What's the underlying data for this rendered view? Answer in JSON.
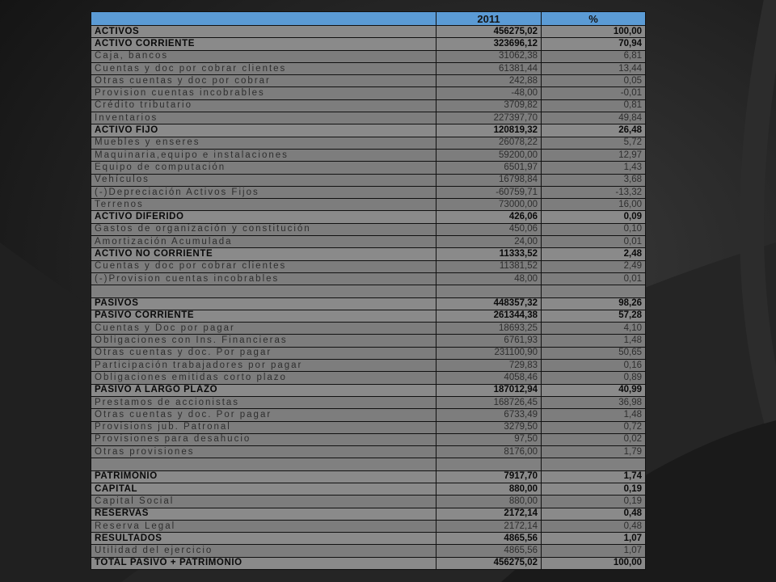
{
  "header": {
    "year": "2011",
    "pct": "%"
  },
  "rows": [
    {
      "label": "ACTIVOS",
      "value": "456275,02",
      "pct": "100,00",
      "bold": true
    },
    {
      "label": "ACTIVO CORRIENTE",
      "value": "323696,12",
      "pct": "70,94",
      "bold": true
    },
    {
      "label": "Caja, bancos",
      "value": "31062,38",
      "pct": "6,81",
      "bold": false
    },
    {
      "label": "Cuentas y doc por cobrar clientes",
      "value": "61381,44",
      "pct": "13,44",
      "bold": false
    },
    {
      "label": "Otras cuentas y doc por cobrar",
      "value": "242,88",
      "pct": "0,05",
      "bold": false
    },
    {
      "label": "Provision cuentas incobrables",
      "value": "-48,00",
      "pct": "-0,01",
      "bold": false
    },
    {
      "label": "Crédito tributario",
      "value": "3709,82",
      "pct": "0,81",
      "bold": false
    },
    {
      "label": "Inventarios",
      "value": "227397,70",
      "pct": "49,84",
      "bold": false
    },
    {
      "label": "ACTIVO FIJO",
      "value": "120819,32",
      "pct": "26,48",
      "bold": true
    },
    {
      "label": "Muebles y enseres",
      "value": "26078,22",
      "pct": "5,72",
      "bold": false
    },
    {
      "label": "Maquinaria,equipo e instalaciones",
      "value": "59200,00",
      "pct": "12,97",
      "bold": false
    },
    {
      "label": "Equipo de computación",
      "value": "6501,97",
      "pct": "1,43",
      "bold": false
    },
    {
      "label": "Vehículos",
      "value": "16798,84",
      "pct": "3,68",
      "bold": false
    },
    {
      "label": "(-)Depreciación Activos Fijos",
      "value": "-60759,71",
      "pct": "-13,32",
      "bold": false
    },
    {
      "label": "Terrenos",
      "value": "73000,00",
      "pct": "16,00",
      "bold": false
    },
    {
      "label": "ACTIVO DIFERIDO",
      "value": "426,06",
      "pct": "0,09",
      "bold": true
    },
    {
      "label": "Gastos de organización y constitución",
      "value": "450,06",
      "pct": "0,10",
      "bold": false
    },
    {
      "label": "Amortización Acumulada",
      "value": "24,00",
      "pct": "0,01",
      "bold": false
    },
    {
      "label": "ACTIVO NO CORRIENTE",
      "value": "11333,52",
      "pct": "2,48",
      "bold": true
    },
    {
      "label": "Cuentas y doc por cobrar clientes",
      "value": "11381,52",
      "pct": "2,49",
      "bold": false
    },
    {
      "label": "(-)Provision cuentas incobrables",
      "value": "48,00",
      "pct": "0,01",
      "bold": false
    },
    {
      "label": "",
      "value": "",
      "pct": "",
      "bold": false
    },
    {
      "label": "PASIVOS",
      "value": "448357,32",
      "pct": "98,26",
      "bold": true
    },
    {
      "label": "PASIVO CORRIENTE",
      "value": "261344,38",
      "pct": "57,28",
      "bold": true
    },
    {
      "label": "Cuentas y Doc por pagar",
      "value": "18693,25",
      "pct": "4,10",
      "bold": false
    },
    {
      "label": "Obligaciones con Ins. Financieras",
      "value": "6761,93",
      "pct": "1,48",
      "bold": false
    },
    {
      "label": "Otras cuentas y doc. Por pagar",
      "value": "231100,90",
      "pct": "50,65",
      "bold": false
    },
    {
      "label": "Participación trabajadores por pagar",
      "value": "729,83",
      "pct": "0,16",
      "bold": false
    },
    {
      "label": "Obligaciones emitidas corto plazo",
      "value": "4058,46",
      "pct": "0,89",
      "bold": false
    },
    {
      "label": "PASIVO A LARGO PLAZO",
      "value": "187012,94",
      "pct": "40,99",
      "bold": true
    },
    {
      "label": "Prestamos de accionistas",
      "value": "168726,45",
      "pct": "36,98",
      "bold": false
    },
    {
      "label": "Otras cuentas y doc. Por pagar",
      "value": "6733,49",
      "pct": "1,48",
      "bold": false
    },
    {
      "label": "Provisions jub. Patronal",
      "value": "3279,50",
      "pct": "0,72",
      "bold": false
    },
    {
      "label": "Provisiones para desahucio",
      "value": "97,50",
      "pct": "0,02",
      "bold": false
    },
    {
      "label": "Otras provisiones",
      "value": "8176,00",
      "pct": "1,79",
      "bold": false
    },
    {
      "label": "",
      "value": "",
      "pct": "",
      "bold": false
    },
    {
      "label": "PATRIMONIO",
      "value": "7917,70",
      "pct": "1,74",
      "bold": true
    },
    {
      "label": "CAPITAL",
      "value": "880,00",
      "pct": "0,19",
      "bold": true
    },
    {
      "label": "Capital Social",
      "value": "880,00",
      "pct": "0,19",
      "bold": false
    },
    {
      "label": "RESERVAS",
      "value": "2172,14",
      "pct": "0,48",
      "bold": true
    },
    {
      "label": "Reserva Legal",
      "value": "2172,14",
      "pct": "0,48",
      "bold": false
    },
    {
      "label": "RESULTADOS",
      "value": "4865,56",
      "pct": "1,07",
      "bold": true
    },
    {
      "label": "Utilidad del ejercicio",
      "value": "4865,56",
      "pct": "1,07",
      "bold": false
    },
    {
      "label": "TOTAL PASIVO + PATRIMONIO",
      "value": "456275,02",
      "pct": "100,00",
      "bold": true
    }
  ],
  "colors": {
    "header": "#5b9bd5",
    "cell": "#7d7d7d",
    "background": "#1b1b1b"
  }
}
